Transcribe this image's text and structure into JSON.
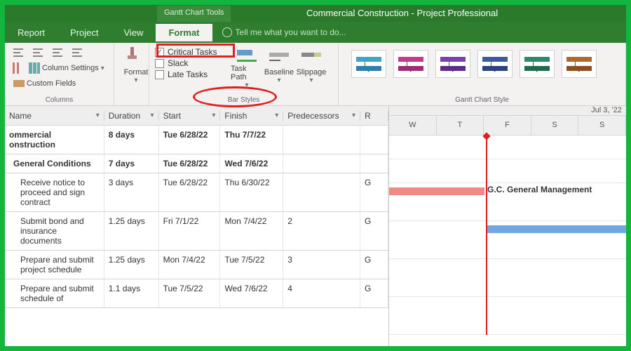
{
  "title": {
    "tools_tab": "Gantt Chart Tools",
    "app": "Commercial Construction - Project Professional"
  },
  "tabs": {
    "report": "Report",
    "project": "Project",
    "view": "View",
    "format": "Format",
    "tellme": "Tell me what you want to do..."
  },
  "ribbon": {
    "columns": {
      "settings": "Column Settings",
      "custom": "Custom Fields",
      "label": "Columns"
    },
    "format_btn": "Format",
    "checks": {
      "critical": "Critical Tasks",
      "slack": "Slack",
      "late": "Late Tasks"
    },
    "barstyles_label": "Bar Styles",
    "taskpath": "Task Path",
    "baseline": "Baseline",
    "slippage": "Slippage",
    "gantt_style_label": "Gantt Chart Style"
  },
  "grid": {
    "headers": {
      "name": "Name",
      "dur": "Duration",
      "start": "Start",
      "finish": "Finish",
      "pred": "Predecessors",
      "res": "R"
    },
    "rows": [
      {
        "name": "ommercial onstruction",
        "dur": "8 days",
        "start": "Tue 6/28/22",
        "finish": "Thu 7/7/22",
        "pred": "",
        "res": "",
        "bold": true,
        "indent": 0
      },
      {
        "name": "General Conditions",
        "dur": "7 days",
        "start": "Tue 6/28/22",
        "finish": "Wed 7/6/22",
        "pred": "",
        "res": "",
        "bold": true,
        "indent": 1
      },
      {
        "name": "Receive notice to proceed and sign contract",
        "dur": "3 days",
        "start": "Tue 6/28/22",
        "finish": "Thu 6/30/22",
        "pred": "",
        "res": "G",
        "indent": 2
      },
      {
        "name": "Submit bond and insurance documents",
        "dur": "1.25 days",
        "start": "Fri 7/1/22",
        "finish": "Mon 7/4/22",
        "pred": "2",
        "res": "G",
        "indent": 2
      },
      {
        "name": "Prepare and submit project schedule",
        "dur": "1.25 days",
        "start": "Mon 7/4/22",
        "finish": "Tue 7/5/22",
        "pred": "3",
        "res": "G",
        "indent": 2
      },
      {
        "name": "Prepare and submit schedule of",
        "dur": "1.1 days",
        "start": "Tue 7/5/22",
        "finish": "Wed 7/6/22",
        "pred": "4",
        "res": "G",
        "indent": 2
      }
    ]
  },
  "gantt": {
    "days": [
      "W",
      "T",
      "F",
      "S",
      "S"
    ],
    "week_label": "Jul 3, '22",
    "bar_label": "G.C. General Management",
    "colors": {
      "critical": "#ef8a87",
      "normal": "#6fa8e2"
    }
  }
}
